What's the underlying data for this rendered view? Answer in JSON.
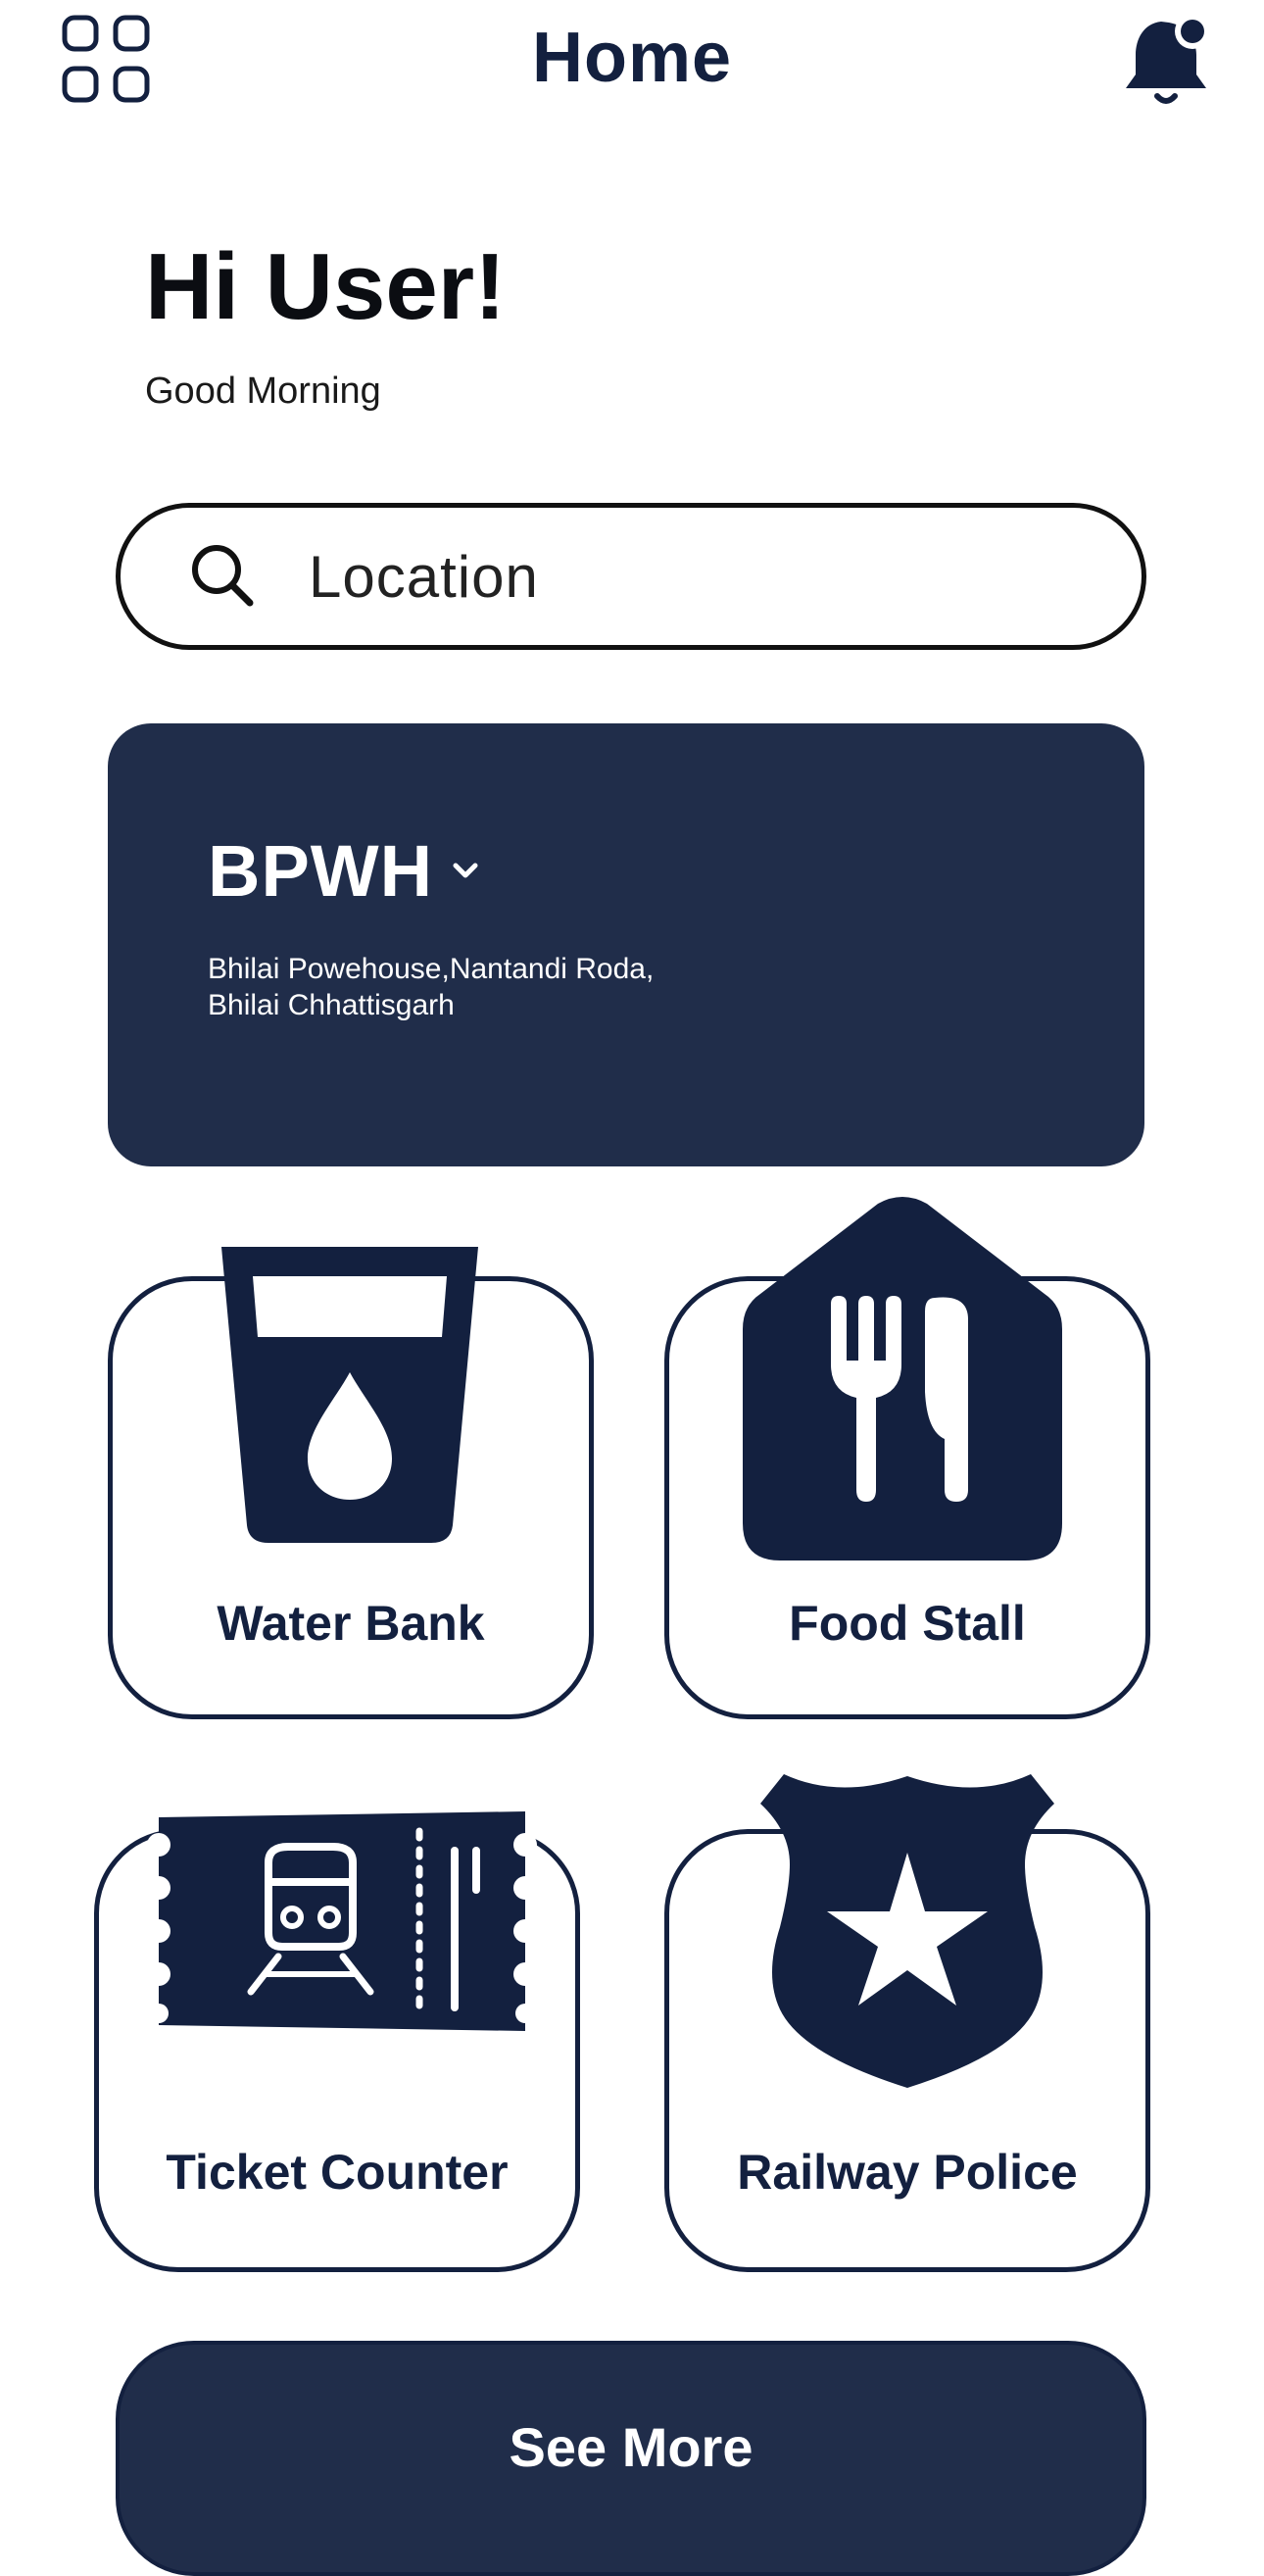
{
  "header": {
    "title": "Home",
    "menu_icon": "grid-menu-icon",
    "notification_icon": "bell-icon"
  },
  "greeting": {
    "title": "Hi User!",
    "subtitle": "Good Morning"
  },
  "search": {
    "placeholder": "Location",
    "icon": "search-icon"
  },
  "station": {
    "code": "BPWH",
    "address_line1": "Bhilai Powehouse,Nantandi Roda,",
    "address_line2": "Bhilai Chhattisgarh"
  },
  "services": [
    {
      "label": "Water Bank",
      "icon": "water-glass-icon"
    },
    {
      "label": "Food Stall",
      "icon": "fork-knife-icon"
    },
    {
      "label": "Ticket Counter",
      "icon": "train-ticket-icon"
    },
    {
      "label": "Railway Police",
      "icon": "police-badge-icon"
    }
  ],
  "actions": {
    "see_more": "See More"
  },
  "colors": {
    "primary": "#13203f",
    "card": "#202d4a",
    "background": "#ffffff"
  }
}
